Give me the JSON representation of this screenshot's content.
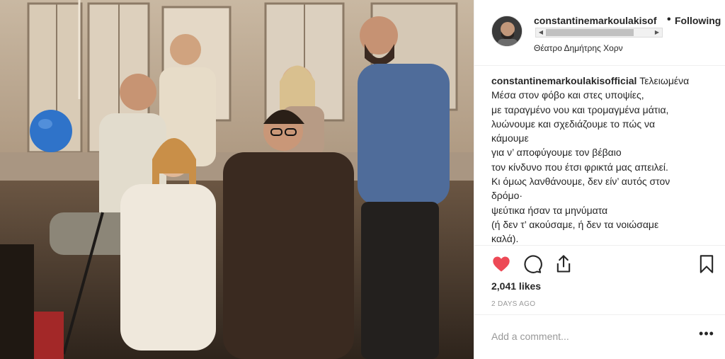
{
  "post": {
    "photo": {
      "alt_icon": "photo-scene"
    },
    "header": {
      "username": "constantinemarkoulakisof",
      "separator": "•",
      "follow_label": "Following",
      "location": "Θέατρο Δημήτρης Χορν",
      "scroll_left": "◀",
      "scroll_right": "▶"
    },
    "caption": {
      "username": "constantinemarkoulakisofficial",
      "lines": [
        "Τελειωμένα",
        "Μέσα στον φόβο και στες υποψίες,",
        "με ταραγμένο νου και τρομαγμένα μάτια,",
        "λυώνουμε και σχεδιάζουμε το πώς να",
        "κάμουμε",
        "για ν’ αποφύγουμε τον βέβαιο",
        "τον κίνδυνο που έτσι φρικτά μας απειλεί.",
        "Κι όμως λανθάνουμε, δεν είν’ αυτός στον",
        "δρόμο·",
        "ψεύτικα ήσαν τα μηνύματα",
        "(ή δεν τ’ ακούσαμε, ή δεν τα νοιώσαμε",
        "καλά)."
      ]
    },
    "actions": {
      "like_icon": "heart-icon",
      "comment_icon": "comment-icon",
      "share_icon": "share-icon",
      "save_icon": "bookmark-icon",
      "likes": "2,041 likes",
      "time": "2 DAYS AGO"
    },
    "comment": {
      "placeholder": "Add a comment...",
      "more_label": "•••"
    },
    "colors": {
      "like_red": "#ed4956",
      "text": "#262626",
      "muted": "#999999",
      "border": "#efefef"
    }
  }
}
